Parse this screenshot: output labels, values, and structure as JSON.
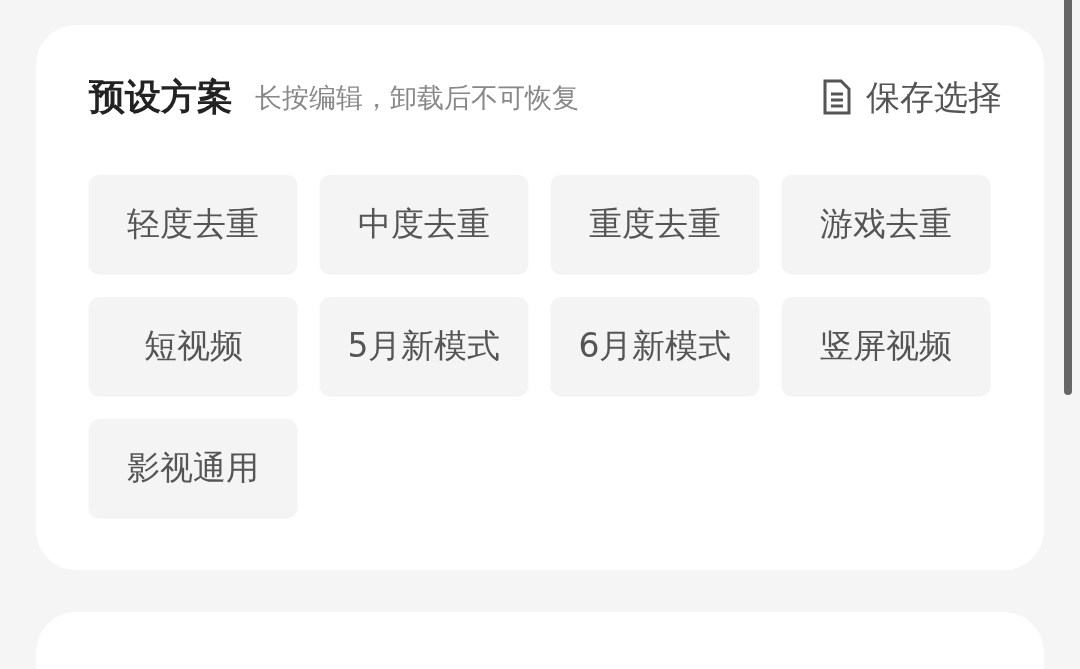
{
  "presets": {
    "title": "预设方案",
    "hint": "长按编辑，卸载后不可恢复",
    "save_button": "保存选择",
    "items": [
      "轻度去重",
      "中度去重",
      "重度去重",
      "游戏去重",
      "短视频",
      "5月新模式",
      "6月新模式",
      "竖屏视频",
      "影视通用"
    ]
  }
}
